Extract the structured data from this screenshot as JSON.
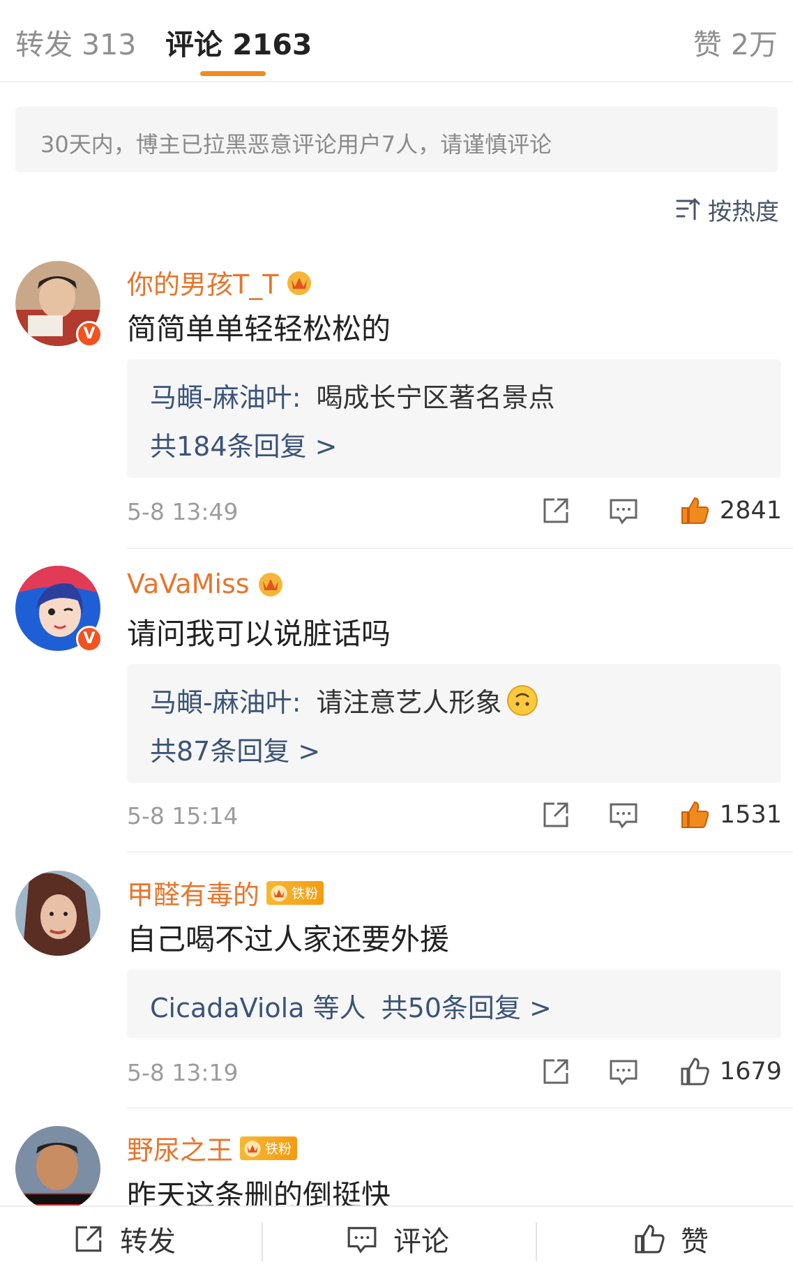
{
  "tabs": {
    "repost": "转发 313",
    "comments": "评论 2163",
    "likes": "赞 2万"
  },
  "notice": "30天内，博主已拉黑恶意评论用户7人，请谨慎评论",
  "sort_label": "按热度",
  "comments": [
    {
      "user": "你的男孩T_T",
      "text": "简简单单轻轻松松的",
      "reply_preview": {
        "author": "马頔-麻油叶:",
        "text": "喝成长宁区著名景点"
      },
      "reply_count": "共184条回复 >",
      "time": "5-8 13:49",
      "likes": "2841"
    },
    {
      "user": "VaVaMiss",
      "text": "请问我可以说脏话吗",
      "reply_preview": {
        "author": "马頔-麻油叶:",
        "text": "请注意艺人形象"
      },
      "reply_count": "共87条回复 >",
      "time": "5-8 15:14",
      "likes": "1531"
    },
    {
      "user": "甲醛有毒的",
      "fan_badge": "铁粉",
      "text": "自己喝不过人家还要外援",
      "reply_others": "CicadaViola 等人",
      "reply_count": "共50条回复 >",
      "time": "5-8 13:19",
      "likes": "1679"
    },
    {
      "user": "野尿之王",
      "fan_badge": "铁粉",
      "text": "昨天这条删的倒挺快"
    }
  ],
  "bottom_bar": {
    "repost": "转发",
    "comment": "评论",
    "like": "赞"
  },
  "colors": {
    "accent_orange": "#e8742a",
    "reply_link": "#3a5378",
    "like_active": "#f08a1c"
  }
}
